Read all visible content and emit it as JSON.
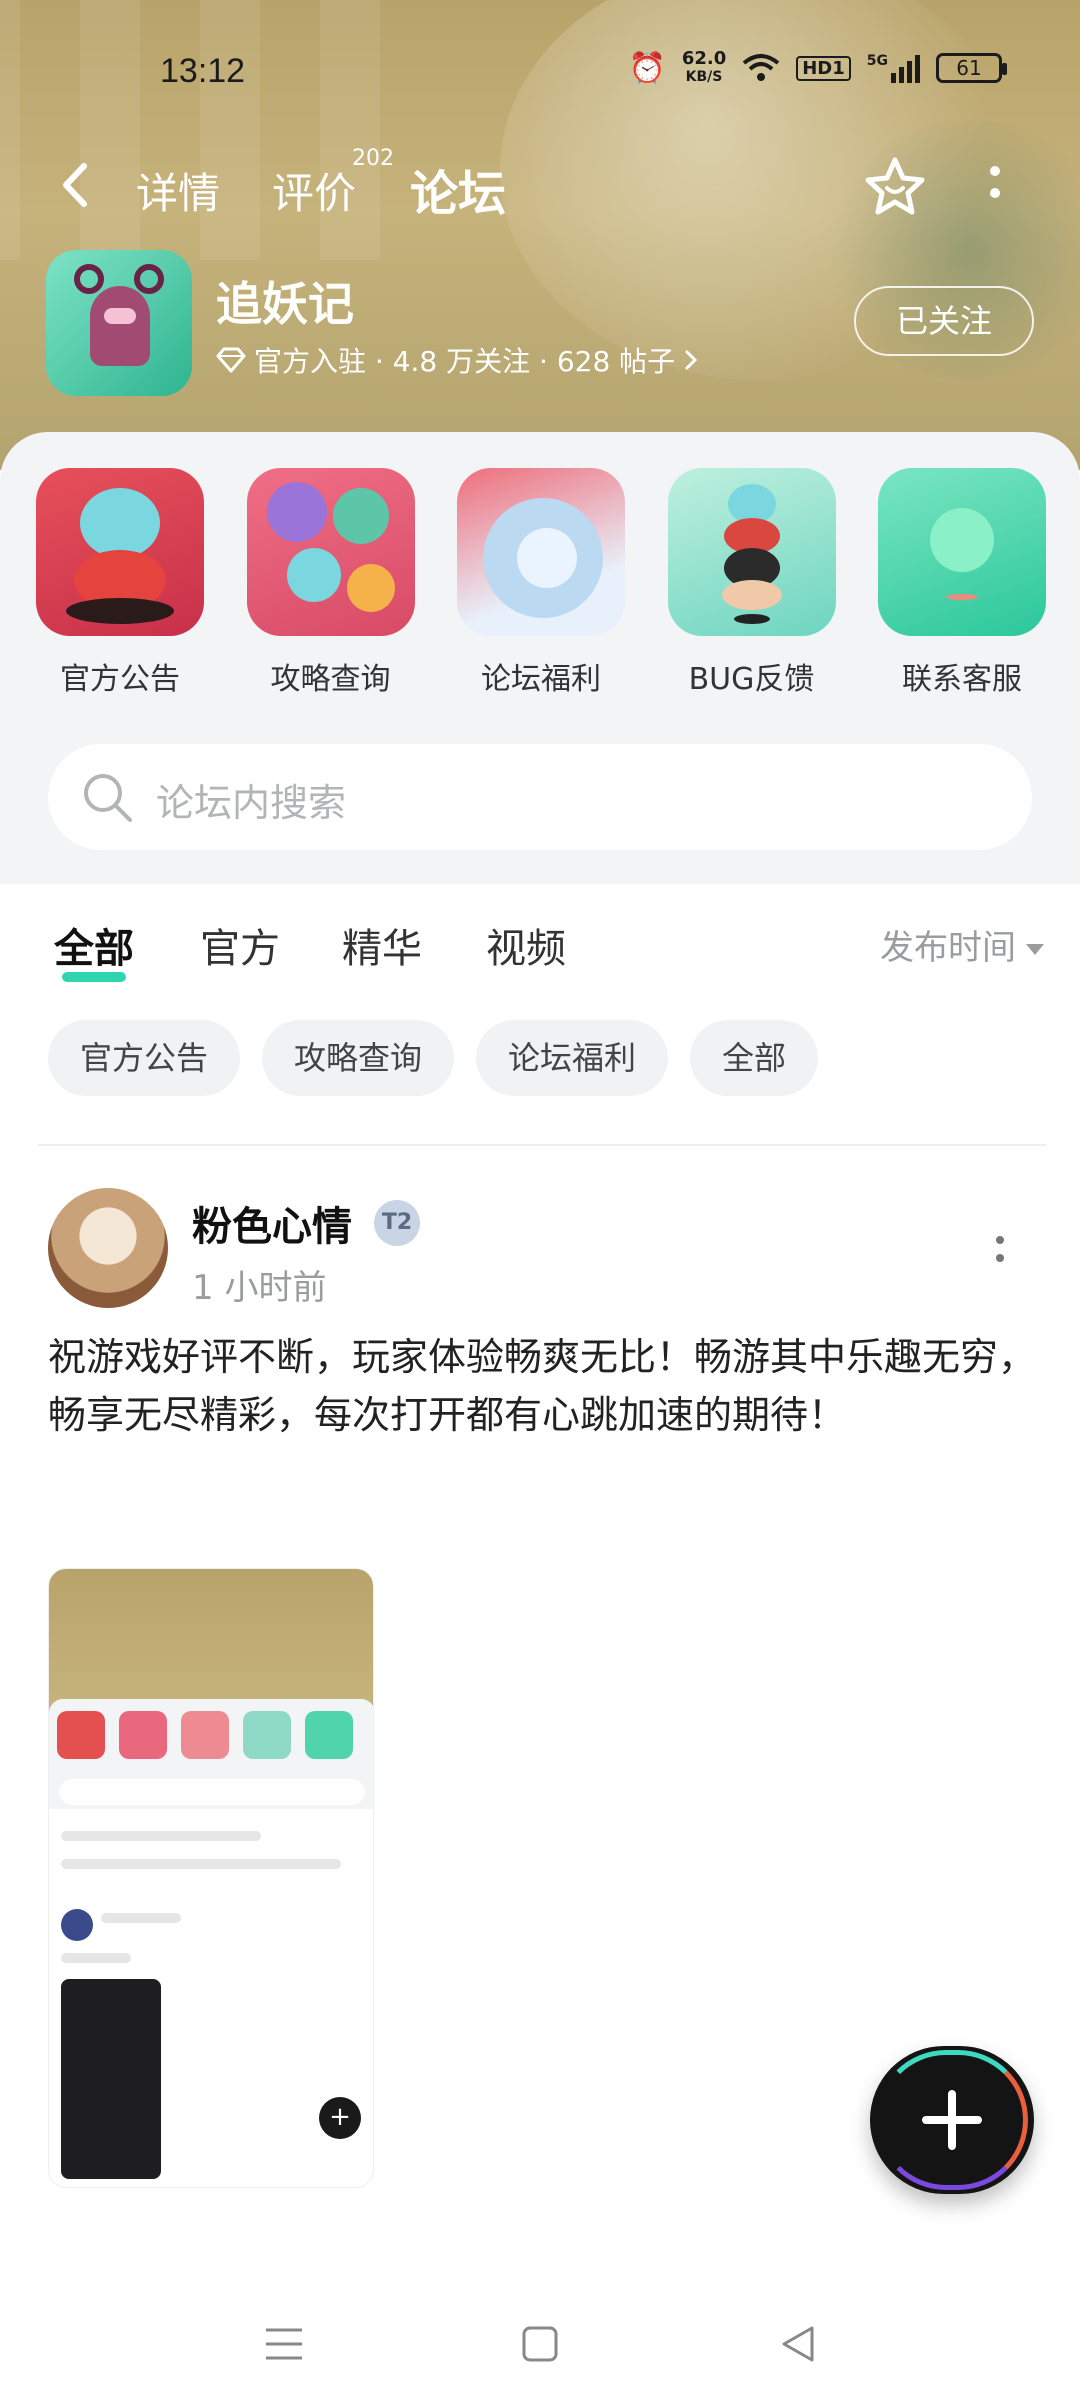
{
  "status_bar": {
    "time": "13:12",
    "net_speed_value": "62.0",
    "net_speed_unit": "KB/S",
    "hd_label": "HD1",
    "signal_label": "5G",
    "battery": "61",
    "icons": [
      "alarm-icon",
      "wifi-icon",
      "signal-icon",
      "battery-icon"
    ]
  },
  "nav": {
    "tabs": [
      {
        "label": "详情"
      },
      {
        "label": "评价",
        "badge": "202"
      },
      {
        "label": "论坛",
        "active": true
      }
    ]
  },
  "game": {
    "name": "追妖记",
    "meta": "官方入驻 · 4.8 万关注 · 628 帖子",
    "follow_label": "已关注"
  },
  "shortcuts": [
    {
      "label": "官方公告"
    },
    {
      "label": "攻略查询"
    },
    {
      "label": "论坛福利"
    },
    {
      "label": "BUG反馈"
    },
    {
      "label": "联系客服"
    }
  ],
  "search": {
    "placeholder": "论坛内搜索"
  },
  "filter_tabs": [
    {
      "label": "全部",
      "active": true
    },
    {
      "label": "官方"
    },
    {
      "label": "精华"
    },
    {
      "label": "视频"
    }
  ],
  "sort_label": "发布时间",
  "chips": [
    "官方公告",
    "攻略查询",
    "论坛福利",
    "全部"
  ],
  "post": {
    "username": "粉色心情",
    "level": "2",
    "time": "1 小时前",
    "text": "祝游戏好评不断，玩家体验畅爽无比！畅游其中乐趣无穷，畅享无尽精彩，每次打开都有心跳加速的期待！"
  },
  "colors": {
    "accent": "#2fd5b0",
    "header_bg": "#bba66e",
    "panel_bg": "#f3f4f6",
    "text_muted": "#9a9ca0"
  }
}
